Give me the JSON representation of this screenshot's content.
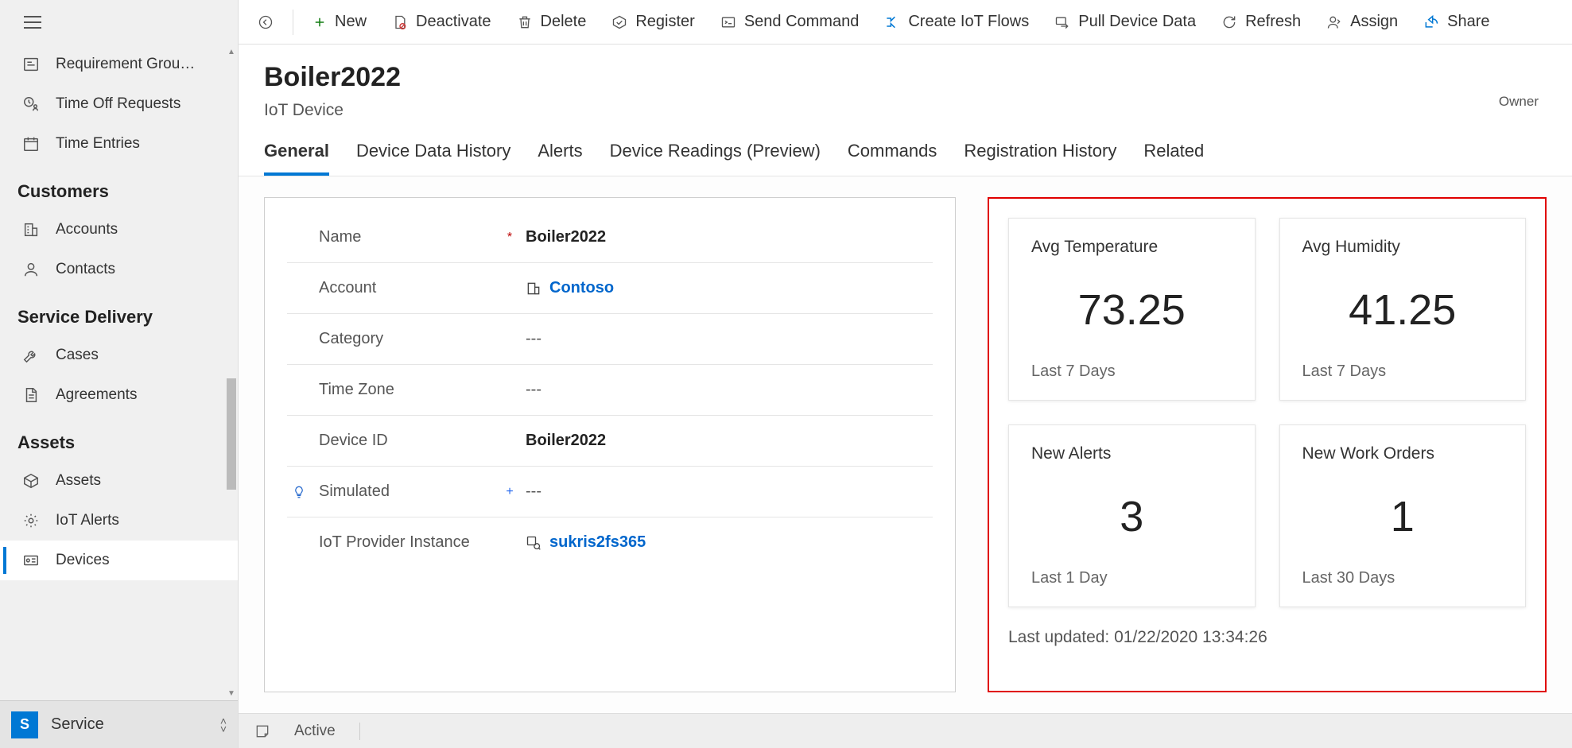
{
  "sidebar": {
    "items_top": [
      {
        "label": "Requirement Grou…"
      },
      {
        "label": "Time Off Requests"
      },
      {
        "label": "Time Entries"
      }
    ],
    "sections": [
      {
        "heading": "Customers",
        "items": [
          {
            "label": "Accounts"
          },
          {
            "label": "Contacts"
          }
        ]
      },
      {
        "heading": "Service Delivery",
        "items": [
          {
            "label": "Cases"
          },
          {
            "label": "Agreements"
          }
        ]
      },
      {
        "heading": "Assets",
        "items": [
          {
            "label": "Assets"
          },
          {
            "label": "IoT Alerts"
          },
          {
            "label": "Devices",
            "active": true
          }
        ]
      }
    ]
  },
  "area": {
    "badge": "S",
    "label": "Service"
  },
  "commands": {
    "new": "New",
    "deactivate": "Deactivate",
    "delete": "Delete",
    "register": "Register",
    "send_command": "Send Command",
    "create_flows": "Create IoT Flows",
    "pull_data": "Pull Device Data",
    "refresh": "Refresh",
    "assign": "Assign",
    "share": "Share"
  },
  "header": {
    "title": "Boiler2022",
    "subtitle": "IoT Device",
    "owner_label": "Owner"
  },
  "tabs": [
    "General",
    "Device Data History",
    "Alerts",
    "Device Readings (Preview)",
    "Commands",
    "Registration History",
    "Related"
  ],
  "form": {
    "name": {
      "label": "Name",
      "value": "Boiler2022"
    },
    "account": {
      "label": "Account",
      "value": "Contoso"
    },
    "category": {
      "label": "Category",
      "value": "---"
    },
    "timezone": {
      "label": "Time Zone",
      "value": "---"
    },
    "device_id": {
      "label": "Device ID",
      "value": "Boiler2022"
    },
    "simulated": {
      "label": "Simulated",
      "value": "---"
    },
    "provider": {
      "label": "IoT Provider Instance",
      "value": "sukris2fs365"
    }
  },
  "metrics": {
    "tiles": [
      {
        "title": "Avg Temperature",
        "value": "73.25",
        "foot": "Last 7 Days"
      },
      {
        "title": "Avg Humidity",
        "value": "41.25",
        "foot": "Last 7 Days"
      },
      {
        "title": "New Alerts",
        "value": "3",
        "foot": "Last 1 Day"
      },
      {
        "title": "New Work Orders",
        "value": "1",
        "foot": "Last 30 Days"
      }
    ],
    "last_updated": "Last updated: 01/22/2020 13:34:26"
  },
  "status": {
    "state": "Active"
  }
}
